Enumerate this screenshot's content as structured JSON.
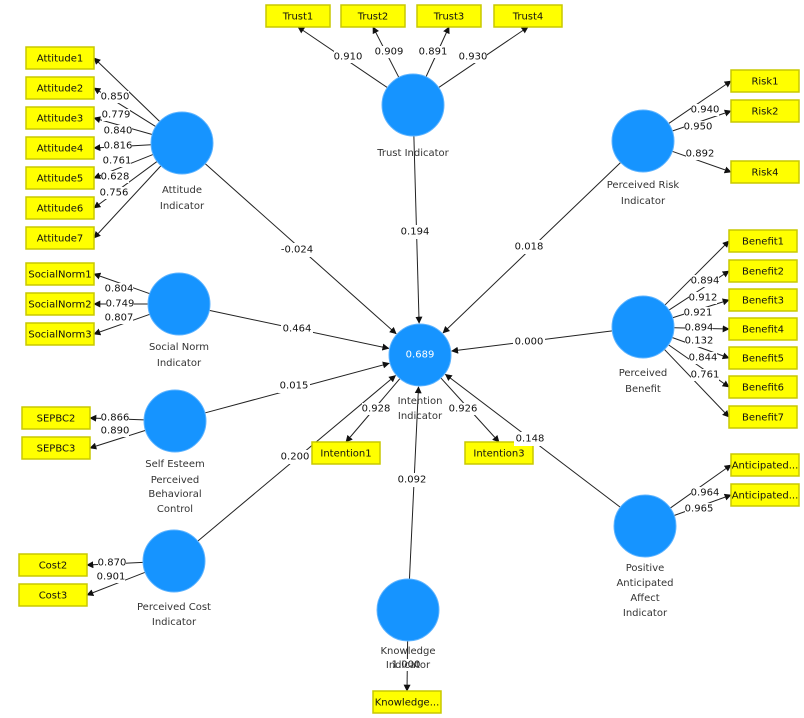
{
  "colors": {
    "construct": "#1694ff",
    "indicator": "#ffff00",
    "line": "#222222"
  },
  "constructs": [
    {
      "id": "attitude",
      "label_lines": [
        "Attitude",
        "Indicator"
      ]
    },
    {
      "id": "trust",
      "label_lines": [
        "Trust Indicator"
      ]
    },
    {
      "id": "risk",
      "label_lines": [
        "Perceived Risk",
        "Indicator"
      ]
    },
    {
      "id": "social",
      "label_lines": [
        "Social Norm",
        "Indicator"
      ]
    },
    {
      "id": "sepbc",
      "label_lines": [
        "Self Esteem",
        "Perceived",
        "Behavioral",
        "Control"
      ]
    },
    {
      "id": "cost",
      "label_lines": [
        "Perceived Cost",
        "Indicator"
      ]
    },
    {
      "id": "intention",
      "label_lines": [
        "Intention",
        "Indicator"
      ],
      "r_squared": "0.689"
    },
    {
      "id": "benefit",
      "label_lines": [
        "Perceived",
        "Benefit"
      ]
    },
    {
      "id": "paa",
      "label_lines": [
        "Positive",
        "Anticipated",
        "Affect",
        "Indicator"
      ]
    },
    {
      "id": "knowledge",
      "label_lines": [
        "Knowledge",
        "Indicator"
      ]
    }
  ],
  "indicators": {
    "attitude": [
      {
        "label": "Attitude1",
        "loading": "0.850"
      },
      {
        "label": "Attitude2",
        "loading": "0.779"
      },
      {
        "label": "Attitude3",
        "loading": "0.840"
      },
      {
        "label": "Attitude4",
        "loading": "0.816"
      },
      {
        "label": "Attitude5",
        "loading": "0.761"
      },
      {
        "label": "Attitude6",
        "loading": "0.628"
      },
      {
        "label": "Attitude7",
        "loading": "0.756"
      }
    ],
    "trust": [
      {
        "label": "Trust1",
        "loading": "0.910"
      },
      {
        "label": "Trust2",
        "loading": "0.909"
      },
      {
        "label": "Trust3",
        "loading": "0.891"
      },
      {
        "label": "Trust4",
        "loading": "0.930"
      }
    ],
    "risk": [
      {
        "label": "Risk1",
        "loading": "0.940"
      },
      {
        "label": "Risk2",
        "loading": "0.950"
      },
      {
        "label": "Risk4",
        "loading": "0.892"
      }
    ],
    "social": [
      {
        "label": "SocialNorm1",
        "loading": "0.804"
      },
      {
        "label": "SocialNorm2",
        "loading": "0.749"
      },
      {
        "label": "SocialNorm3",
        "loading": "0.807"
      }
    ],
    "sepbc": [
      {
        "label": "SEPBC2",
        "loading": "0.866"
      },
      {
        "label": "SEPBC3",
        "loading": "0.890"
      }
    ],
    "cost": [
      {
        "label": "Cost2",
        "loading": "0.870"
      },
      {
        "label": "Cost3",
        "loading": "0.901"
      }
    ],
    "intention": [
      {
        "label": "Intention1",
        "loading": "0.928"
      },
      {
        "label": "Intention3",
        "loading": "0.926"
      }
    ],
    "benefit": [
      {
        "label": "Benefit1",
        "loading": "0.894"
      },
      {
        "label": "Benefit2",
        "loading": "0.912"
      },
      {
        "label": "Benefit3",
        "loading": "0.921"
      },
      {
        "label": "Benefit4",
        "loading": "0.894"
      },
      {
        "label": "Benefit5",
        "loading": "0.132"
      },
      {
        "label": "Benefit6",
        "loading": "0.844"
      },
      {
        "label": "Benefit7",
        "loading": "0.761"
      }
    ],
    "paa": [
      {
        "label": "Anticipated...",
        "loading": "0.964"
      },
      {
        "label": "Anticipated...",
        "loading": "0.965"
      }
    ],
    "knowledge": [
      {
        "label": "Knowledge...",
        "loading": "1.000"
      }
    ]
  },
  "paths": [
    {
      "from": "attitude",
      "to": "intention",
      "coefficient": "-0.024"
    },
    {
      "from": "social",
      "to": "intention",
      "coefficient": "0.464"
    },
    {
      "from": "sepbc",
      "to": "intention",
      "coefficient": "0.015"
    },
    {
      "from": "cost",
      "to": "intention",
      "coefficient": "0.200"
    },
    {
      "from": "trust",
      "to": "intention",
      "coefficient": "0.194"
    },
    {
      "from": "risk",
      "to": "intention",
      "coefficient": "0.018"
    },
    {
      "from": "benefit",
      "to": "intention",
      "coefficient": "0.000"
    },
    {
      "from": "paa",
      "to": "intention",
      "coefficient": "0.148"
    },
    {
      "from": "knowledge",
      "to": "intention",
      "coefficient": "0.092"
    }
  ]
}
